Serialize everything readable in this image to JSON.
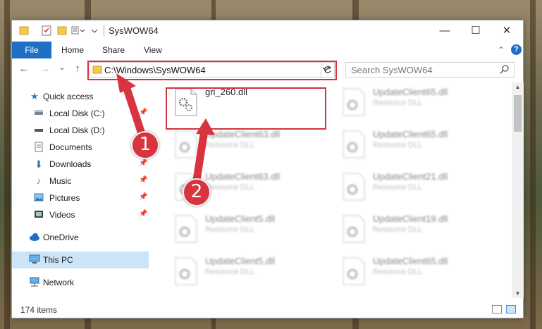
{
  "window": {
    "title": "SysWOW64",
    "controls": {
      "minimize": "—",
      "maximize": "☐",
      "close": "✕"
    }
  },
  "ribbon": {
    "file_tab": "File",
    "tabs": [
      "Home",
      "Share",
      "View"
    ],
    "chevron": "⌃",
    "help": "?"
  },
  "address": {
    "path": "C:\\Windows\\SysWOW64",
    "dropdown_icon": "chevron-down-icon",
    "refresh_icon": "refresh-icon"
  },
  "search": {
    "placeholder": "Search SysWOW64"
  },
  "nav": {
    "back": "←",
    "forward": "→",
    "recent": "⌄",
    "up": "↑"
  },
  "sidebar": {
    "items": [
      {
        "label": "Quick access",
        "icon": "star-icon",
        "pinned": false
      },
      {
        "label": "Local Disk (C:)",
        "icon": "drive-icon",
        "pinned": true
      },
      {
        "label": "Local Disk (D:)",
        "icon": "drive-icon",
        "pinned": false
      },
      {
        "label": "Documents",
        "icon": "document-icon",
        "pinned": true
      },
      {
        "label": "Downloads",
        "icon": "download-icon",
        "pinned": true
      },
      {
        "label": "Music",
        "icon": "music-icon",
        "pinned": true
      },
      {
        "label": "Pictures",
        "icon": "pictures-icon",
        "pinned": true
      },
      {
        "label": "Videos",
        "icon": "videos-icon",
        "pinned": true
      },
      {
        "label": "OneDrive",
        "icon": "cloud-icon",
        "pinned": false
      },
      {
        "label": "This PC",
        "icon": "pc-icon",
        "pinned": false,
        "selected": true
      },
      {
        "label": "Network",
        "icon": "network-icon",
        "pinned": false
      }
    ]
  },
  "files": [
    {
      "name": "gri_260.dll",
      "type": "",
      "highlighted": true
    },
    {
      "name": "UpdateClient65.dll",
      "type": "Resource DLL"
    },
    {
      "name": "UpdateClient63.dll",
      "type": "Resource DLL"
    },
    {
      "name": "UpdateClient65.dll",
      "type": "Resource DLL"
    },
    {
      "name": "UpdateClient63.dll",
      "type": "Resource DLL"
    },
    {
      "name": "UpdateClient21.dll",
      "type": "Resource DLL"
    },
    {
      "name": "UpdateClient5.dll",
      "type": "Resource DLL"
    },
    {
      "name": "UpdateClient19.dll",
      "type": "Resource DLL"
    },
    {
      "name": "UpdateClient5.dll",
      "type": "Resource DLL"
    },
    {
      "name": "UpdateClient65.dll",
      "type": "Resource DLL"
    }
  ],
  "status": {
    "item_count": "174 items"
  },
  "annotations": {
    "marker1": "1",
    "marker2": "2",
    "color": "#d8333f"
  },
  "colors": {
    "accent": "#1f6fc5",
    "highlight": "#d3343e",
    "selected": "#cce4f7"
  }
}
